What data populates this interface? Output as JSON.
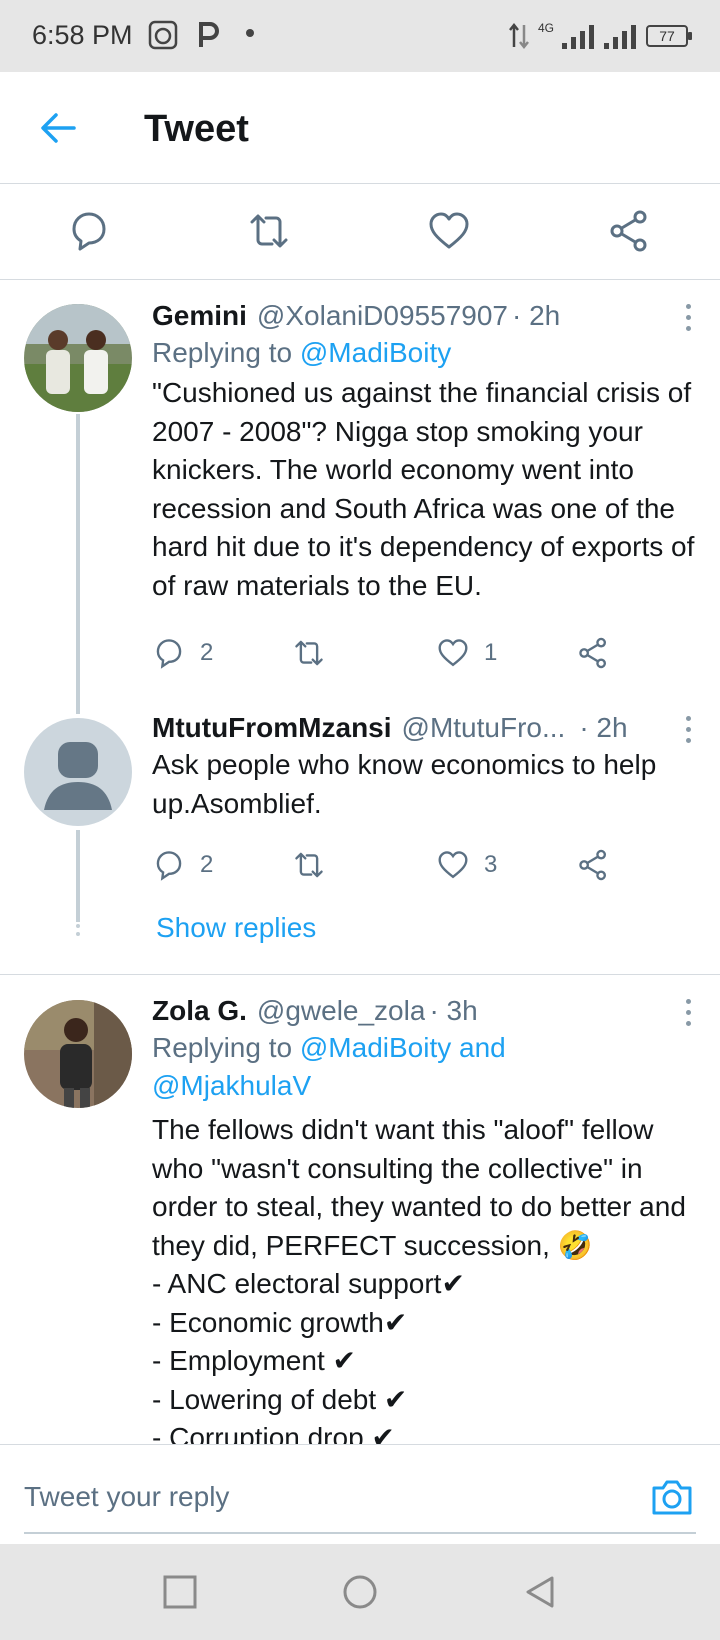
{
  "status_bar": {
    "time": "6:58 PM",
    "network": "4G",
    "battery": "77"
  },
  "header": {
    "title": "Tweet"
  },
  "tweets": [
    {
      "name": "Gemini",
      "handle": "@XolaniD09557907",
      "time": "· 2h",
      "replying_prefix": "Replying to ",
      "replying_to": "@MadiBoity",
      "text": "\"Cushioned us against the financial crisis of 2007 - 2008\"? Nigga stop smoking your knickers. The world economy went into recession and South Africa was one of the hard hit due to it's dependency of exports of of raw materials to the EU.",
      "replies": "2",
      "likes": "1"
    },
    {
      "name": "MtutuFromMzansi",
      "handle": "@MtutuFro...",
      "time": "· 2h",
      "text": "Ask people who know economics to help up.Asomblief.",
      "replies": "2",
      "likes": "3",
      "show_replies": "Show replies"
    },
    {
      "name": "Zola G.",
      "handle": "@gwele_zola",
      "time": "· 3h",
      "replying_prefix": "Replying to ",
      "replying_to": "@MadiBoity and @MjakhulaV",
      "text_lines": [
        "The fellows didn't want this \"aloof\" fellow who \"wasn't consulting the collective\" in order to steal, they wanted to do better and they did, PERFECT succession, 🤣",
        "- ANC electoral support✔",
        "- Economic growth✔",
        "- Employment ✔",
        "- Lowering of debt ✔",
        "- Corruption drop ✔"
      ]
    }
  ],
  "reply_bar": {
    "placeholder": "Tweet your reply"
  },
  "colors": {
    "accent": "#1da1f2",
    "text": "#14171a",
    "muted": "#5b7083"
  }
}
